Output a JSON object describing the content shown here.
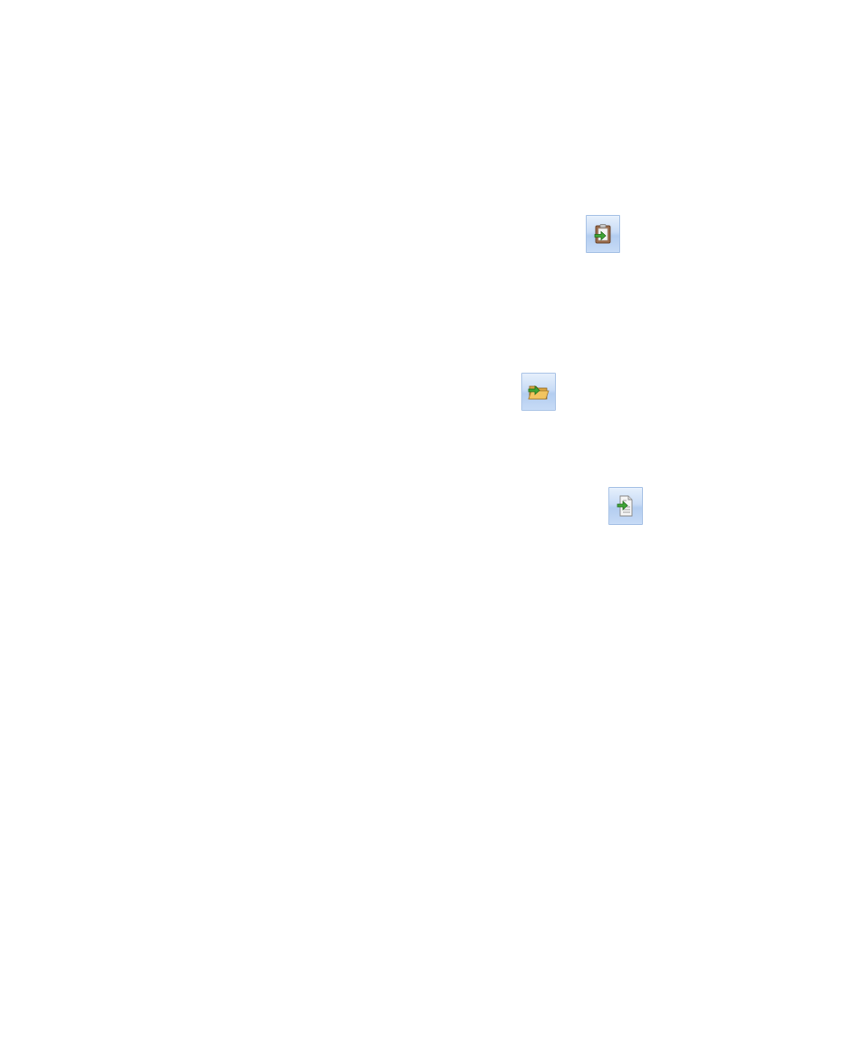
{
  "buttons": [
    {
      "id": "paste-import",
      "icon": "clipboard-import-icon"
    },
    {
      "id": "open-folder-import",
      "icon": "folder-import-icon"
    },
    {
      "id": "document-import",
      "icon": "document-import-icon"
    }
  ],
  "colors": {
    "button_gradient_top": "#e6f0fc",
    "button_gradient_bottom": "#b3cdf0",
    "button_border": "#a9c3e6",
    "arrow_green": "#3fa535"
  }
}
